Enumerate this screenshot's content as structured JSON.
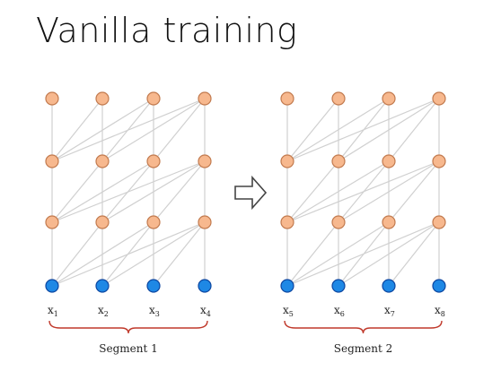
{
  "title": "Vanilla training",
  "colors": {
    "hidden_node": "#F7B88E",
    "hidden_stroke": "#C27A4E",
    "input_node": "#1E88E5",
    "input_stroke": "#0D47A1",
    "edge": "#D0D0D0",
    "brace": "#C0392B",
    "arrow": "#444444"
  },
  "arrow_icon": "right-arrow-icon",
  "segments": [
    {
      "label": "Segment 1",
      "inputs": [
        {
          "base": "x",
          "sub": "1"
        },
        {
          "base": "x",
          "sub": "2"
        },
        {
          "base": "x",
          "sub": "3"
        },
        {
          "base": "x",
          "sub": "4"
        }
      ]
    },
    {
      "label": "Segment 2",
      "inputs": [
        {
          "base": "x",
          "sub": "5"
        },
        {
          "base": "x",
          "sub": "6"
        },
        {
          "base": "x",
          "sub": "7"
        },
        {
          "base": "x",
          "sub": "8"
        }
      ]
    }
  ],
  "network": {
    "layers": 4,
    "nodes_per_layer": 4,
    "context": 4
  }
}
